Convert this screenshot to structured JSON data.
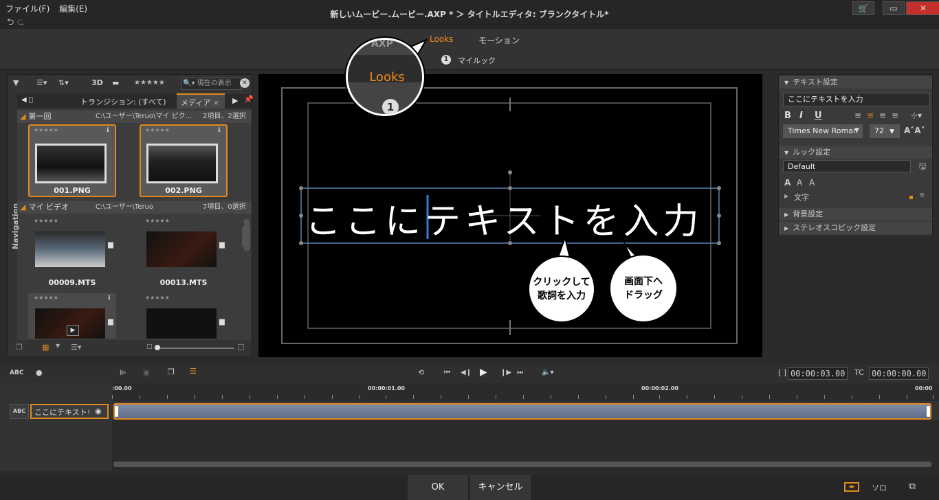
{
  "menu": {
    "file": "ファイル(F)",
    "edit": "編集(E)"
  },
  "window": {
    "title": "新しいムービー.ムービー.AXP * ＞ タイトルエディタ: ブランクタイトル*"
  },
  "mode_tabs": {
    "looks": "Looks",
    "motion": "モーション",
    "looks_sub": "マイルック",
    "looks_sub_num": "1"
  },
  "zoom_callout": {
    "label": "Looks",
    "ghost": "AXP",
    "num": "1"
  },
  "library": {
    "tab_3d": "3D",
    "stars": "★★★★★",
    "search_placeholder": "現在の表示",
    "tab_prev": "◀ ⃝",
    "tab_transition": "トランジション: (すべて)",
    "tab_media": "メディア",
    "nav_label": "Navigation",
    "groups": [
      {
        "name": "第一回",
        "path": "C:\\ユーザー\\Teruo\\マイ ピク...",
        "count": "2項目、2選択"
      },
      {
        "name": "マイ ビデオ",
        "path": "C:\\ユーザー\\Teruo",
        "count": "7項目、0選択"
      }
    ],
    "items": [
      "001.PNG",
      "002.PNG",
      "00009.MTS",
      "00013.MTS"
    ]
  },
  "preview": {
    "text": "ここにテキストを入力"
  },
  "callouts": {
    "click": "クリックして\n歌詞を入力",
    "drag": "画面下へ\nドラッグ"
  },
  "right_panel": {
    "text_settings": "テキスト設定",
    "text_value": "ここにテキストを入力",
    "bold": "B",
    "italic": "I",
    "underline": "U",
    "font": "Times New Roman",
    "size": "72",
    "look_settings": "ルック設定",
    "look_value": "Default",
    "text_section": "文字",
    "bg_settings": "背景設定",
    "stereo_settings": "ステレオスコピック設定"
  },
  "timeline": {
    "abc": "ABC",
    "tc_in": "00:00:03.00",
    "tc_label": "TC",
    "tc_value": "00:00:00.00",
    "bracket": "[ ]",
    "ruler": [
      ":00.00",
      "00:00:01.00",
      "00:00:02.00",
      "00:00"
    ],
    "track_label": "ここにテキストを..."
  },
  "bottom": {
    "ok": "OK",
    "cancel": "キャンセル",
    "solo": "ソロ"
  }
}
